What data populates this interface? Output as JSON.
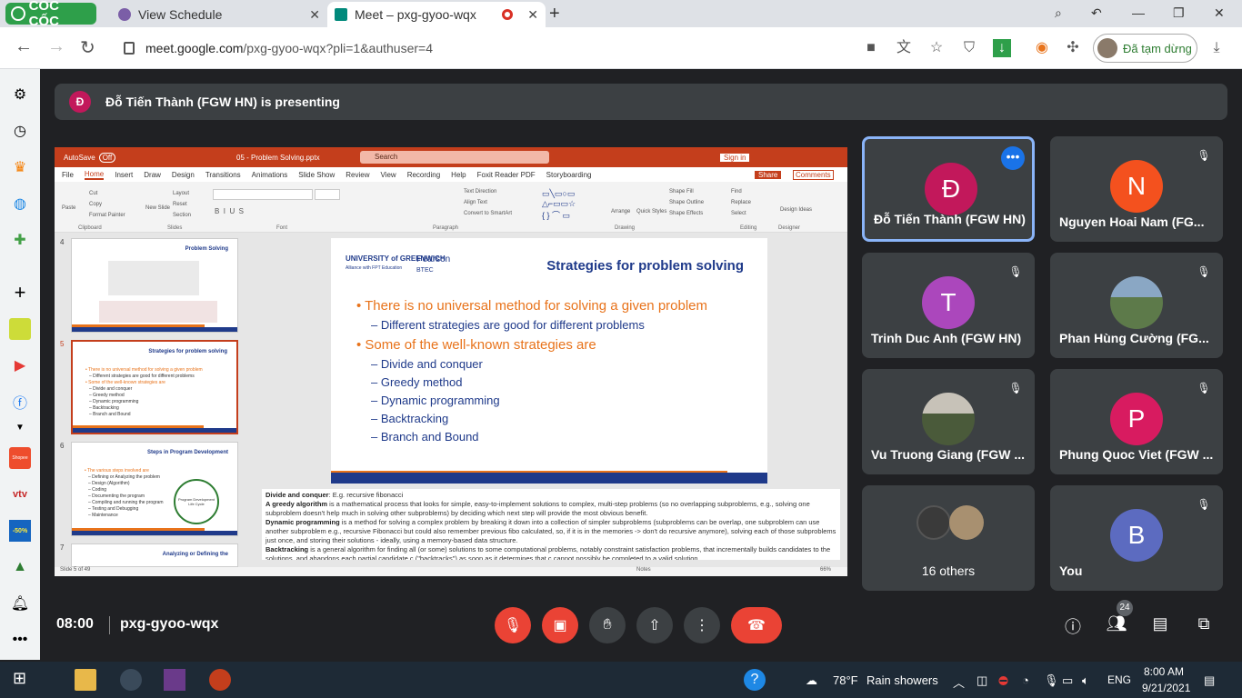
{
  "browser": {
    "brand": "CỐC CỐC",
    "tabs": [
      {
        "title": "View Schedule",
        "close": "✕"
      },
      {
        "title": "Meet – pxg-gyoo-wqx",
        "close": "✕"
      }
    ],
    "new_tab": "+",
    "url_host": "meet.google.com",
    "url_path": "/pxg-gyoo-wqx?pli=1&authuser=4",
    "profile_label": "Đã tạm dừng"
  },
  "meet": {
    "presenter_initial": "Đ",
    "presenter_text": "Đỗ Tiến Thành (FGW HN) is presenting",
    "time": "08:00",
    "meeting_code": "pxg-gyoo-wqx",
    "people_count": "24"
  },
  "ppt": {
    "autosave": "AutoSave",
    "autosave_state": "Off",
    "file_name": "05 - Problem Solving.pptx",
    "search_placeholder": "Search",
    "sign_in": "Sign in",
    "menus": [
      "File",
      "Home",
      "Insert",
      "Draw",
      "Design",
      "Transitions",
      "Animations",
      "Slide Show",
      "Review",
      "View",
      "Recording",
      "Help",
      "Foxit Reader PDF",
      "Storyboarding"
    ],
    "share": "Share",
    "comments": "Comments",
    "ribbon_groups": [
      "Clipboard",
      "Slides",
      "Font",
      "Paragraph",
      "Drawing",
      "Editing",
      "Designer"
    ],
    "ribbon_buttons": {
      "paste": "Paste",
      "cut": "Cut",
      "copy": "Copy",
      "format_painter": "Format Painter",
      "new_slide": "New Slide",
      "layout": "Layout",
      "reset": "Reset",
      "section": "Section",
      "text_direction": "Text Direction",
      "align_text": "Align Text",
      "convert_smartart": "Convert to SmartArt",
      "arrange": "Arrange",
      "quick_styles": "Quick Styles",
      "shape_fill": "Shape Fill",
      "shape_outline": "Shape Outline",
      "shape_effects": "Shape Effects",
      "find": "Find",
      "replace": "Replace",
      "select": "Select",
      "design_ideas": "Design Ideas"
    },
    "thumbnails": [
      {
        "num": "4",
        "title": "Problem Solving"
      },
      {
        "num": "5",
        "title": "Strategies for problem solving",
        "lines": [
          "• There is no universal method for solving a given problem",
          "– Different strategies are good for different problems",
          "• Some of the well-known strategies are",
          "– Divide and conquer",
          "– Greedy method",
          "– Dynamic programming",
          "– Backtracking",
          "– Branch and Bound"
        ]
      },
      {
        "num": "6",
        "title": "Steps in Program Development",
        "lines": [
          "• The various steps involved are",
          "– Defining or Analyzing the problem",
          "– Design (Algorithm)",
          "– Coding",
          "– Documenting the program",
          "– Compiling and running the program",
          "– Testing and Debugging",
          "– Maintenance"
        ],
        "cycle_label": "Program Development Life Cycle"
      },
      {
        "num": "7",
        "title": "Analyzing or Defining the"
      }
    ],
    "slide": {
      "logo_university": "UNIVERSITY of GREENWICH",
      "logo_alliance": "Alliance with FPT Education",
      "logo_pearson": "Pearson",
      "logo_btec": "BTEC",
      "title": "Strategies for problem solving",
      "bullet1": "• There is no universal method for solving a given problem",
      "sub1": "– Different strategies are good for different problems",
      "bullet2": "• Some of the well-known strategies are",
      "subs": [
        "– Divide and conquer",
        "– Greedy method",
        "– Dynamic programming",
        "– Backtracking",
        "– Branch and Bound"
      ]
    },
    "notes": {
      "dc_label": "Divide and conquer",
      "dc_text": ": E.g. recursive fibonacci",
      "greedy_label": "A greedy algorithm",
      "greedy_text": " is a mathematical process that looks for simple, easy-to-implement solutions to complex, multi-step problems (so no overlapping subproblems, e.g., solving one subproblem doesn't help much in solving other subproblems) by deciding which next step will provide the most obvious benefit.",
      "dp_label": "Dynamic programming",
      "dp_text": " is a method for solving a complex problem by breaking it down into a collection of simpler subproblems (subproblems can be overlap, one subproblem can use another subproblem e.g., recursive Fibonacci but could also remember previous fibo calculated, so, if it is in the memories -> don't do recursive anymore), solving each of those subproblems just once, and storing their solutions - ideally, using a memory-based data structure.",
      "bt_label": "Backtracking",
      "bt_text": " is a general algorithm for finding all (or some) solutions to some computational problems, notably constraint satisfaction problems, that incrementally builds candidates to the solutions, and abandons each partial candidate c (\"backtracks\") as soon as it determines that c cannot possibly be completed to a valid solution"
    },
    "status_slide": "Slide 5 of 49",
    "status_notes": "Notes",
    "zoom": "66%"
  },
  "participants": [
    {
      "initial": "Đ",
      "name": "Đỗ Tiến Thành (FGW HN)",
      "color": "#c2185b"
    },
    {
      "initial": "N",
      "name": "Nguyen Hoai Nam (FG...",
      "color": "#f4511e"
    },
    {
      "initial": "T",
      "name": "Trinh Duc Anh (FGW HN)",
      "color": "#ab47bc"
    },
    {
      "initial": "",
      "name": "Phan Hùng Cường (FG...",
      "color": "#6d8a5a"
    },
    {
      "initial": "",
      "name": "Vu Truong Giang (FGW ...",
      "color": "#7a8a70"
    },
    {
      "initial": "P",
      "name": "Phung Quoc Viet (FGW ...",
      "color": "#d81b60"
    },
    {
      "initial": "",
      "name": "16 others",
      "color": "#5a4a40"
    },
    {
      "initial": "B",
      "name": "You",
      "color": "#5c6bc0"
    }
  ],
  "taskbar": {
    "weather_temp": "78°F",
    "weather_text": "Rain showers",
    "lang": "ENG",
    "clock_time": "8:00 AM",
    "clock_date": "9/21/2021"
  },
  "sidebar_extras": {
    "shopee_label": "Shopee",
    "sale_label": "-50%"
  }
}
